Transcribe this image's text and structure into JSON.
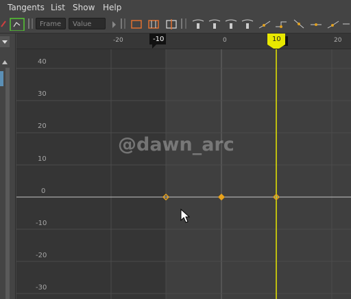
{
  "menu": {
    "tangents": "Tangents",
    "list": "List",
    "show": "Show",
    "help": "Help"
  },
  "toolbar": {
    "frame_placeholder": "Frame",
    "value_placeholder": "Value"
  },
  "timeline": {
    "x_ticks": [
      "-20",
      "-10",
      "0",
      "10",
      "20"
    ],
    "y_ticks": [
      "40",
      "30",
      "20",
      "10",
      "0",
      "-10",
      "-20",
      "-30"
    ],
    "range_start_label": "-10",
    "current_frame_label": "10"
  },
  "watermark": "@dawn_arc",
  "colors": {
    "accent": "#e8e800",
    "key": "#e8a21b",
    "curve": "#c8c8c8"
  }
}
